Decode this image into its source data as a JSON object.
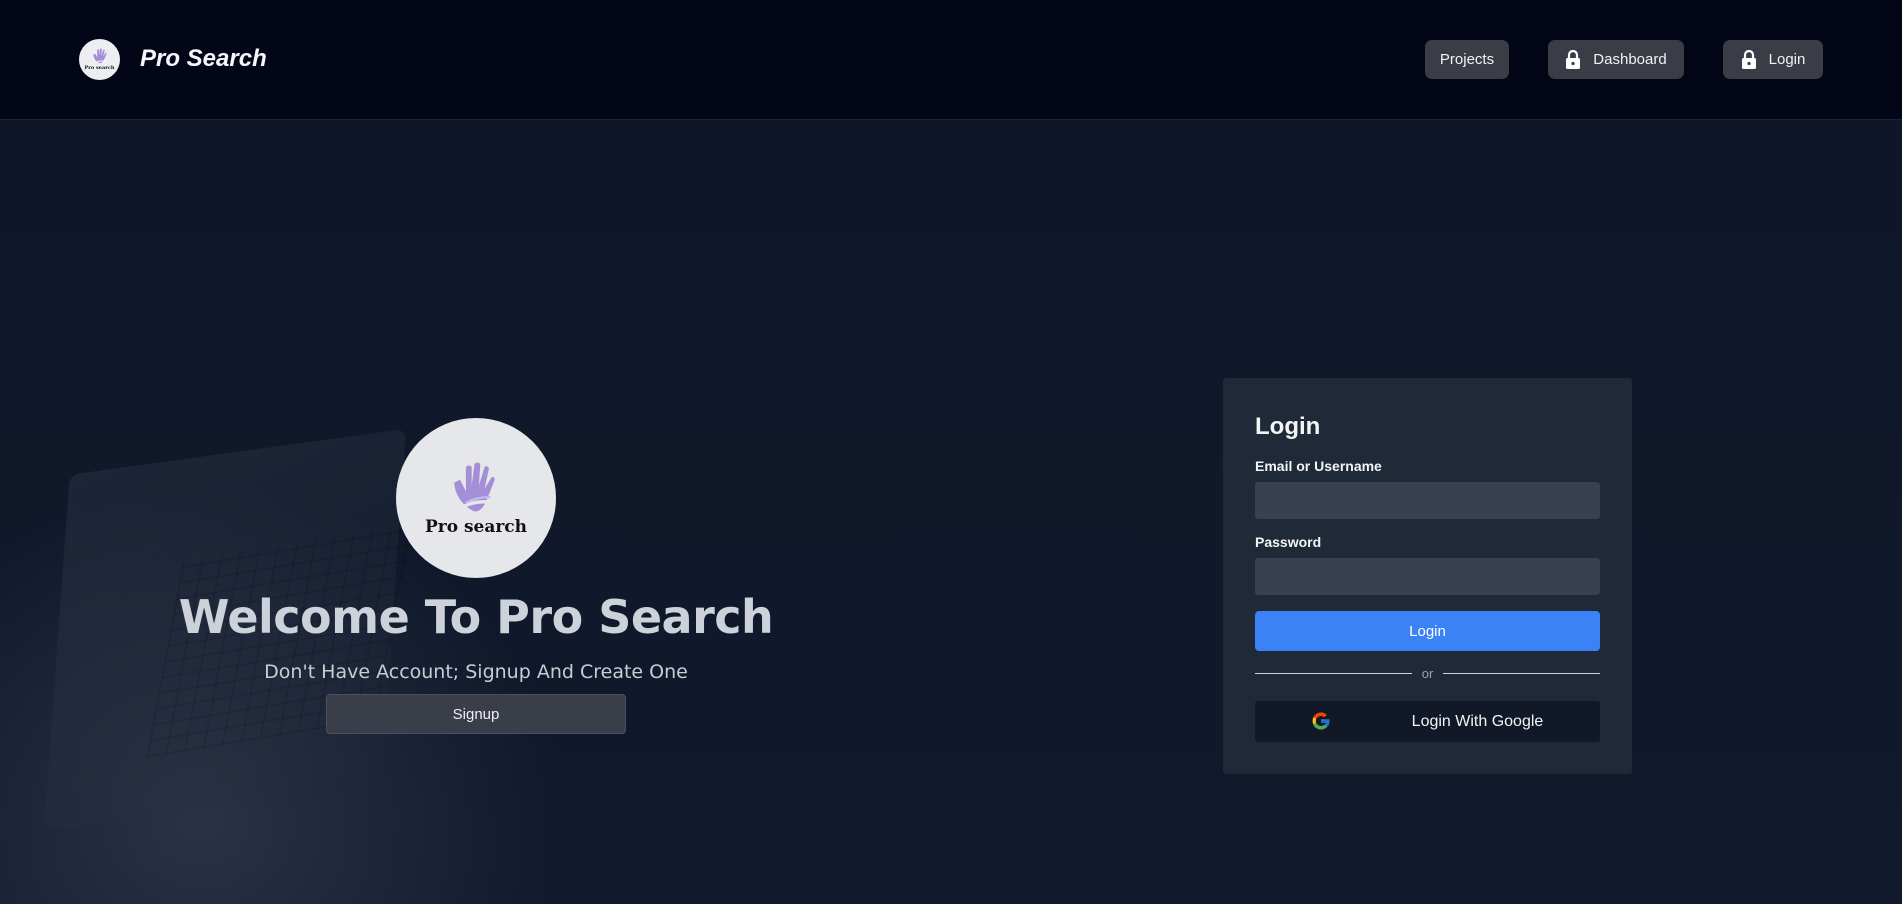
{
  "header": {
    "brand_name": "Pro Search",
    "brand_logo_text": "Pro search",
    "nav": {
      "projects": "Projects",
      "dashboard": "Dashboard",
      "login": "Login"
    }
  },
  "hero": {
    "logo_text": "Pro search",
    "title": "Welcome To Pro Search",
    "subtitle": "Don't Have Account; Signup And Create One",
    "signup_label": "Signup"
  },
  "login_card": {
    "title": "Login",
    "email_label": "Email or Username",
    "email_value": "",
    "password_label": "Password",
    "password_value": "",
    "login_button": "Login",
    "divider_text": "or",
    "google_button": "Login With Google"
  },
  "icons": {
    "brand_logo": "hand-logo-icon",
    "nav_lock": "lock-icon",
    "google": "google-icon"
  },
  "colors": {
    "header_bg": "#030617",
    "page_bg": "#0f1629",
    "card_bg": "#1f2937",
    "input_bg": "#374151",
    "primary": "#3b82f6",
    "nav_button": "#3a3d45",
    "logo_purple": "#a48fd6"
  }
}
